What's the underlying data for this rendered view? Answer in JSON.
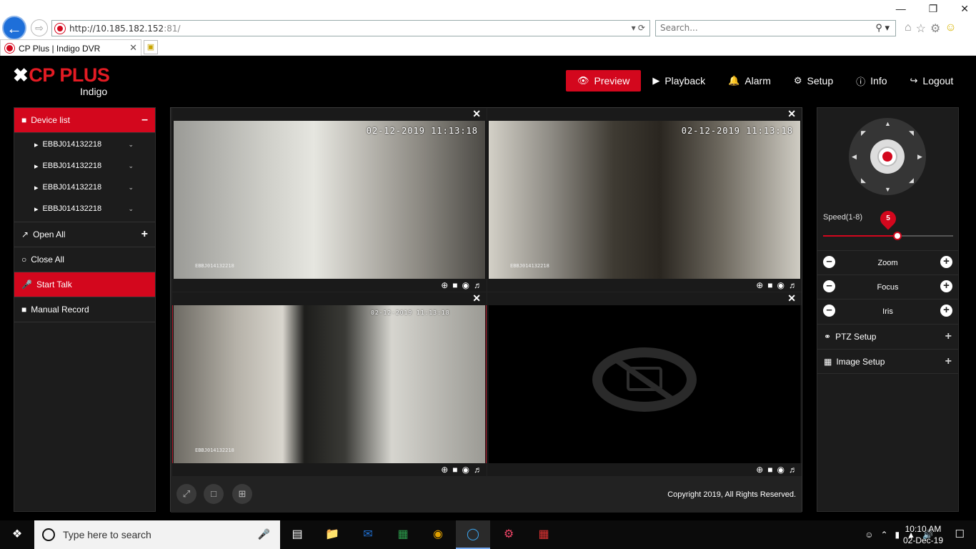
{
  "browser": {
    "url_main": "http://10.185.182.152",
    "url_port": ":81/",
    "search_placeholder": "Search...",
    "tab_title": "CP Plus | Indigo DVR"
  },
  "logo": {
    "brand": "CP PLUS",
    "sub": "Indigo"
  },
  "nav": {
    "preview": "Preview",
    "playback": "Playback",
    "alarm": "Alarm",
    "setup": "Setup",
    "info": "Info",
    "logout": "Logout"
  },
  "left_panel": {
    "device_list": "Device list",
    "devices": [
      "EBBJ014132218",
      "EBBJ014132218",
      "EBBJ014132218",
      "EBBJ014132218"
    ],
    "open_all": "Open All",
    "close_all": "Close All",
    "start_talk": "Start Talk",
    "manual_record": "Manual Record"
  },
  "video": {
    "cells": [
      {
        "timestamp": "02-12-2019 11:13:18",
        "cam_id": "EBBJ014132218"
      },
      {
        "timestamp": "02-12-2019 11:13:18",
        "cam_id": "EBBJ014132218"
      },
      {
        "timestamp": "02-12-2019 11:13:18",
        "cam_id": "EBBJ014132218"
      },
      {
        "timestamp": "",
        "cam_id": ""
      }
    ],
    "copyright": "Copyright 2019, All Rights Reserved."
  },
  "ptz": {
    "speed_label": "Speed(1-8)",
    "speed_value": "5",
    "speed_fraction": 0.57,
    "zoom": "Zoom",
    "focus": "Focus",
    "iris": "Iris",
    "ptz_setup": "PTZ Setup",
    "image_setup": "Image Setup"
  },
  "taskbar": {
    "search_placeholder": "Type here to search",
    "time": "10:10 AM",
    "date": "02-Dec-19"
  },
  "colors": {
    "accent": "#d3071d"
  }
}
